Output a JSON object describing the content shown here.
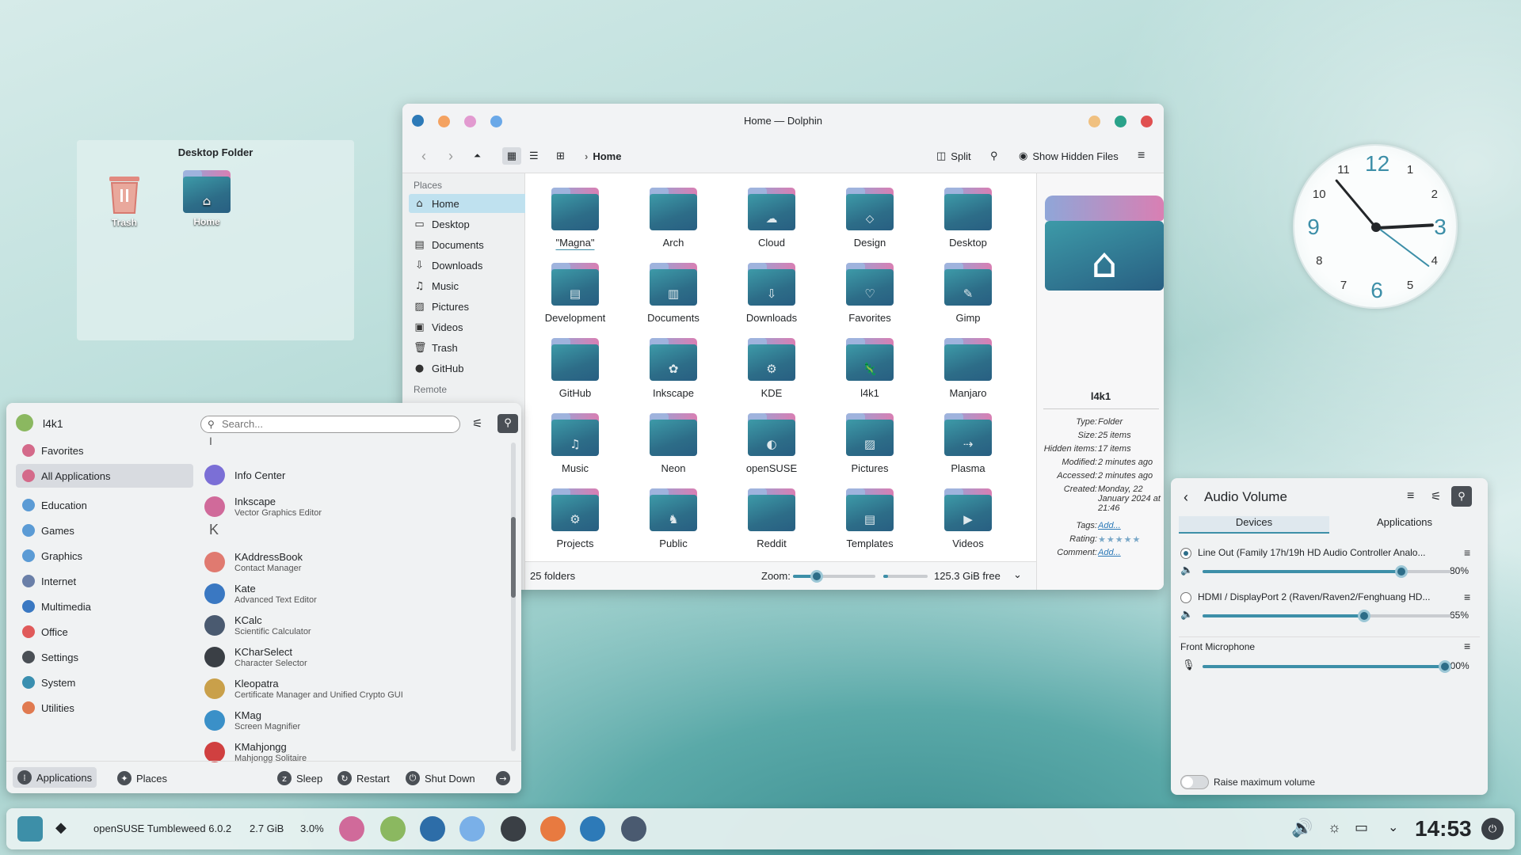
{
  "desktop_folder": {
    "title": "Desktop Folder",
    "items": [
      {
        "label": "Trash"
      },
      {
        "label": "Home"
      }
    ]
  },
  "dolphin": {
    "title": "Home — Dolphin",
    "breadcrumb": "Home",
    "split_label": "Split",
    "show_hidden_label": "Show Hidden Files",
    "places_header": "Places",
    "remote_header": "Remote",
    "places": [
      {
        "label": "Home",
        "icon": "home-icon"
      },
      {
        "label": "Desktop",
        "icon": "desktop-icon"
      },
      {
        "label": "Documents",
        "icon": "documents-icon"
      },
      {
        "label": "Downloads",
        "icon": "downloads-icon"
      },
      {
        "label": "Music",
        "icon": "music-icon"
      },
      {
        "label": "Pictures",
        "icon": "pictures-icon"
      },
      {
        "label": "Videos",
        "icon": "videos-icon"
      },
      {
        "label": "Trash",
        "icon": "trash-icon"
      },
      {
        "label": "GitHub",
        "icon": "github-icon"
      }
    ],
    "folders": [
      "\"Magna\"",
      "Arch",
      "Cloud",
      "Design",
      "Desktop",
      "Development",
      "Documents",
      "Downloads",
      "Favorites",
      "Gimp",
      "GitHub",
      "Inkscape",
      "KDE",
      "l4k1",
      "Manjaro",
      "Music",
      "Neon",
      "openSUSE",
      "Pictures",
      "Plasma",
      "Projects",
      "Public",
      "Reddit",
      "Templates",
      "Videos"
    ],
    "status": "25 folders",
    "zoom_label": "Zoom:",
    "free_space": "125.3 GiB free",
    "info": {
      "name": "l4k1",
      "rows": [
        {
          "k": "Type:",
          "v": "Folder"
        },
        {
          "k": "Size:",
          "v": "25 items"
        },
        {
          "k": "Hidden items:",
          "v": "17 items"
        },
        {
          "k": "Modified:",
          "v": "2 minutes ago"
        },
        {
          "k": "Accessed:",
          "v": "2 minutes ago"
        },
        {
          "k": "Created:",
          "v": "Monday, 22 January 2024 at 21:46"
        },
        {
          "k": "Tags:",
          "v": "Add..."
        },
        {
          "k": "Rating:",
          "v": "★★★★★"
        },
        {
          "k": "Comment:",
          "v": "Add..."
        }
      ]
    }
  },
  "menu": {
    "user": "l4k1",
    "search_placeholder": "Search...",
    "categories": [
      {
        "label": "Favorites",
        "color": "#d46a8a"
      },
      {
        "label": "All Applications",
        "color": "#d46a8a"
      },
      {
        "label": "Education",
        "color": "#5b9bd5"
      },
      {
        "label": "Games",
        "color": "#5b9bd5"
      },
      {
        "label": "Graphics",
        "color": "#5b9bd5"
      },
      {
        "label": "Internet",
        "color": "#6a7fa8"
      },
      {
        "label": "Multimedia",
        "color": "#3a78c2"
      },
      {
        "label": "Office",
        "color": "#e05a5a"
      },
      {
        "label": "Settings",
        "color": "#4a4f55"
      },
      {
        "label": "System",
        "color": "#3a8fb0"
      },
      {
        "label": "Utilities",
        "color": "#e07a50"
      }
    ],
    "letters": [
      "I",
      "K"
    ],
    "apps": [
      {
        "name": "Info Center",
        "sub": "",
        "color": "#7b6fd6"
      },
      {
        "name": "Inkscape",
        "sub": "Vector Graphics Editor",
        "color": "#d06a9a"
      },
      {
        "name": "KAddressBook",
        "sub": "Contact Manager",
        "color": "#e07a70"
      },
      {
        "name": "Kate",
        "sub": "Advanced Text Editor",
        "color": "#3a78c2"
      },
      {
        "name": "KCalc",
        "sub": "Scientific Calculator",
        "color": "#4a5a70"
      },
      {
        "name": "KCharSelect",
        "sub": "Character Selector",
        "color": "#3a3f45"
      },
      {
        "name": "Kleopatra",
        "sub": "Certificate Manager and Unified Crypto GUI",
        "color": "#c9a04a"
      },
      {
        "name": "KMag",
        "sub": "Screen Magnifier",
        "color": "#3a90c8"
      },
      {
        "name": "KMahjongg",
        "sub": "Mahjongg Solitaire",
        "color": "#d04040"
      }
    ],
    "footer": {
      "applications": "Applications",
      "places": "Places",
      "sleep": "Sleep",
      "restart": "Restart",
      "shutdown": "Shut Down"
    }
  },
  "audio": {
    "title": "Audio Volume",
    "tabs": [
      "Devices",
      "Applications"
    ],
    "devices": [
      {
        "name": "Line Out (Family 17h/19h HD Audio Controller Analo...",
        "value": "80%",
        "level": 0.8
      },
      {
        "name": "HDMI / DisplayPort 2 (Raven/Raven2/Fenghuang HD...",
        "value": "65%",
        "level": 0.65
      }
    ],
    "mic": {
      "name": "Front Microphone",
      "value": "100%",
      "level": 1.0
    },
    "raise_label": "Raise maximum volume"
  },
  "taskbar": {
    "os": "openSUSE Tumbleweed 6.0.2",
    "mem": "2.7 GiB",
    "cpu": "3.0%",
    "time": "14:53"
  },
  "clock": {
    "numbers": [
      "12",
      "1",
      "2",
      "3",
      "4",
      "5",
      "6",
      "7",
      "8",
      "9",
      "10",
      "11"
    ]
  }
}
